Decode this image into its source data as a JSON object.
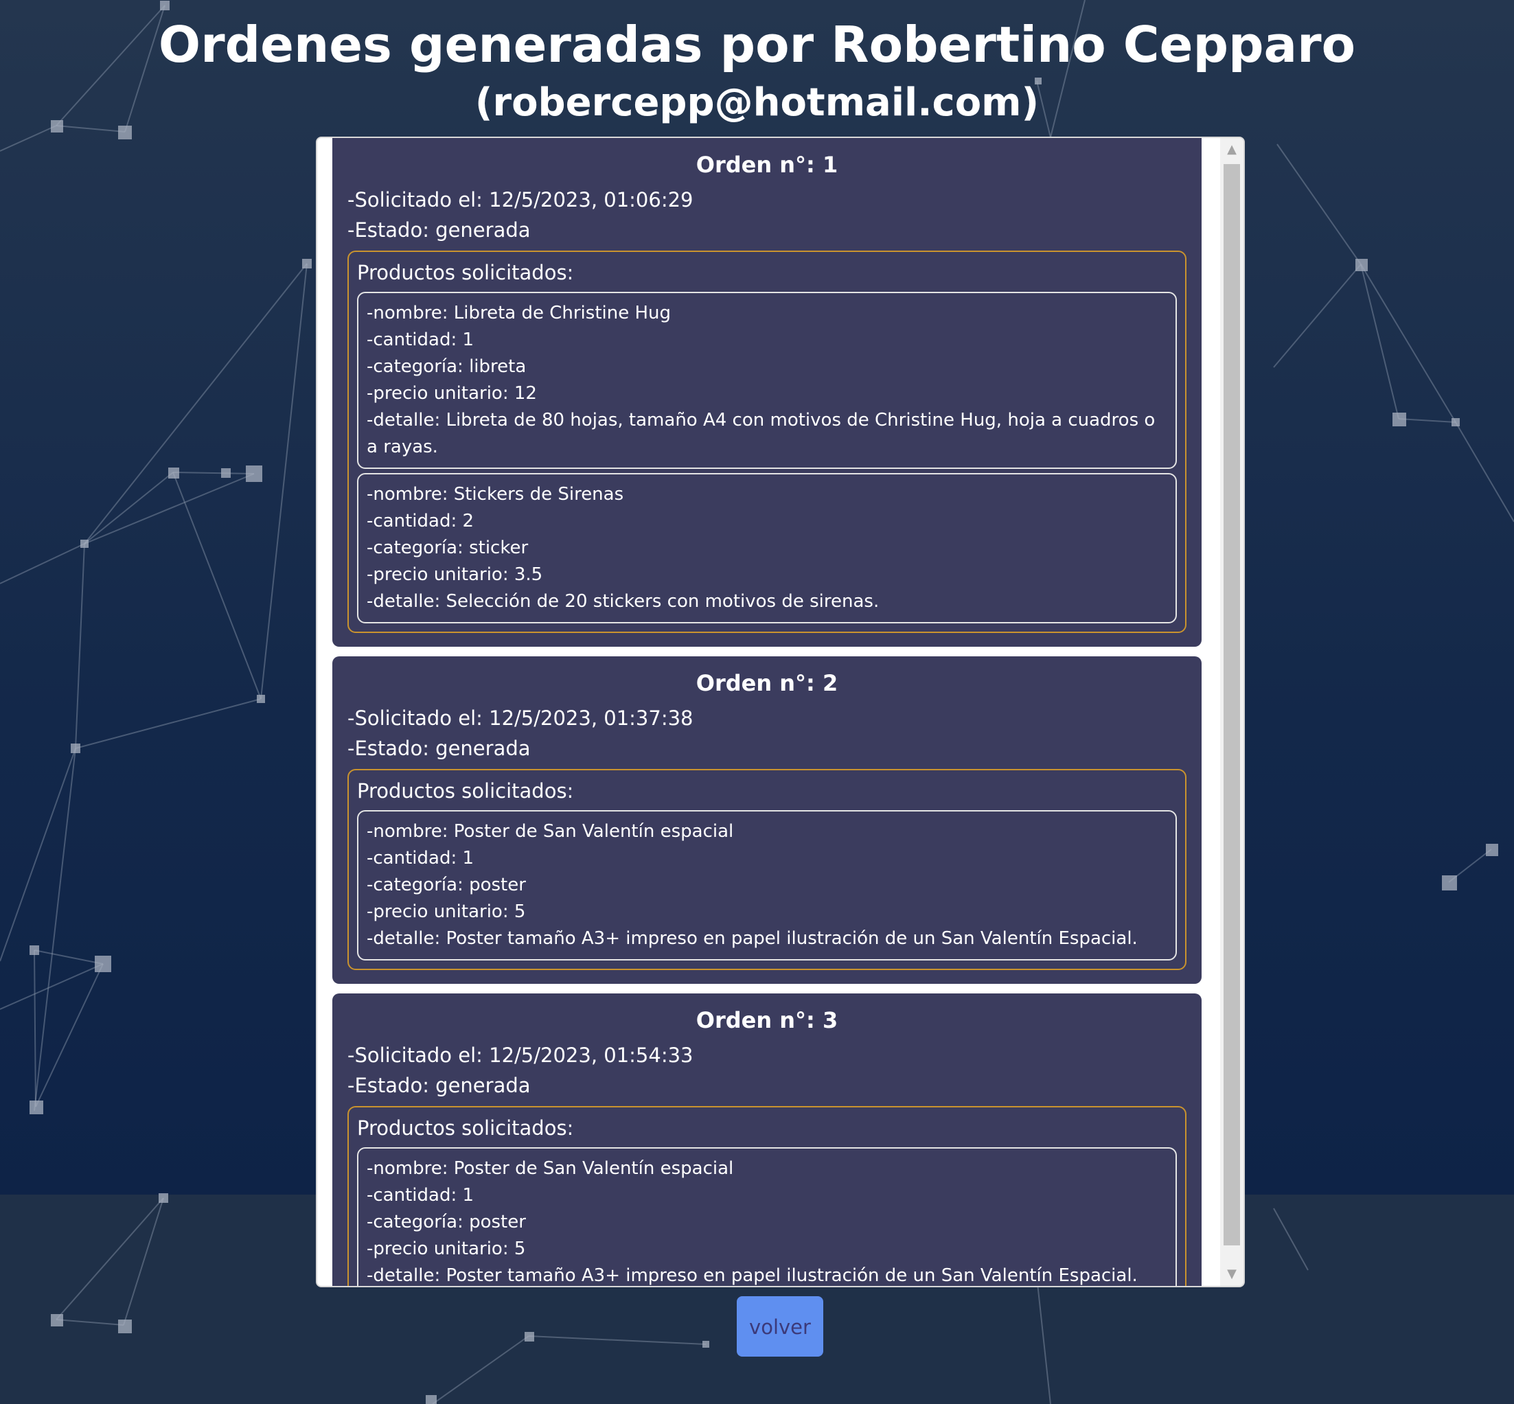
{
  "header": {
    "title": "Ordenes generadas por Robertino Cepparo",
    "subtitle": "(robercepp@hotmail.com)"
  },
  "orders": [
    {
      "title": "Orden n°: 1",
      "requested": "-Solicitado el: 12/5/2023, 01:06:29",
      "status": "-Estado: generada",
      "products_title": "Productos solicitados:",
      "products": [
        {
          "nombre": "-nombre: Libreta de Christine Hug",
          "cantidad": "-cantidad: 1",
          "categoria": "-categoría: libreta",
          "precio": "-precio unitario: 12",
          "detalle": "-detalle: Libreta de 80 hojas, tamaño A4 con motivos de Christine Hug, hoja a cuadros o a rayas."
        },
        {
          "nombre": "-nombre: Stickers de Sirenas",
          "cantidad": "-cantidad: 2",
          "categoria": "-categoría: sticker",
          "precio": "-precio unitario: 3.5",
          "detalle": "-detalle: Selección de 20 stickers con motivos de sirenas."
        }
      ]
    },
    {
      "title": "Orden n°: 2",
      "requested": "-Solicitado el: 12/5/2023, 01:37:38",
      "status": "-Estado: generada",
      "products_title": "Productos solicitados:",
      "products": [
        {
          "nombre": "-nombre: Poster de San Valentín espacial",
          "cantidad": "-cantidad: 1",
          "categoria": "-categoría: poster",
          "precio": "-precio unitario: 5",
          "detalle": "-detalle: Poster tamaño A3+ impreso en papel ilustración de un San Valentín Espacial."
        }
      ]
    },
    {
      "title": "Orden n°: 3",
      "requested": "-Solicitado el: 12/5/2023, 01:54:33",
      "status": "-Estado: generada",
      "products_title": "Productos solicitados:",
      "products": [
        {
          "nombre": "-nombre: Poster de San Valentín espacial",
          "cantidad": "-cantidad: 1",
          "categoria": "-categoría: poster",
          "precio": "-precio unitario: 5",
          "detalle": "-detalle: Poster tamaño A3+ impreso en papel ilustración de un San Valentín Espacial."
        }
      ]
    }
  ],
  "actions": {
    "volver_label": "volver"
  },
  "colors": {
    "background": "#1c2c44",
    "card": "#3b3c5e",
    "products_border": "#c9932e",
    "product_border": "#e4e4e4",
    "button": "#5f8ff0",
    "button_text": "#3c3a7a"
  }
}
